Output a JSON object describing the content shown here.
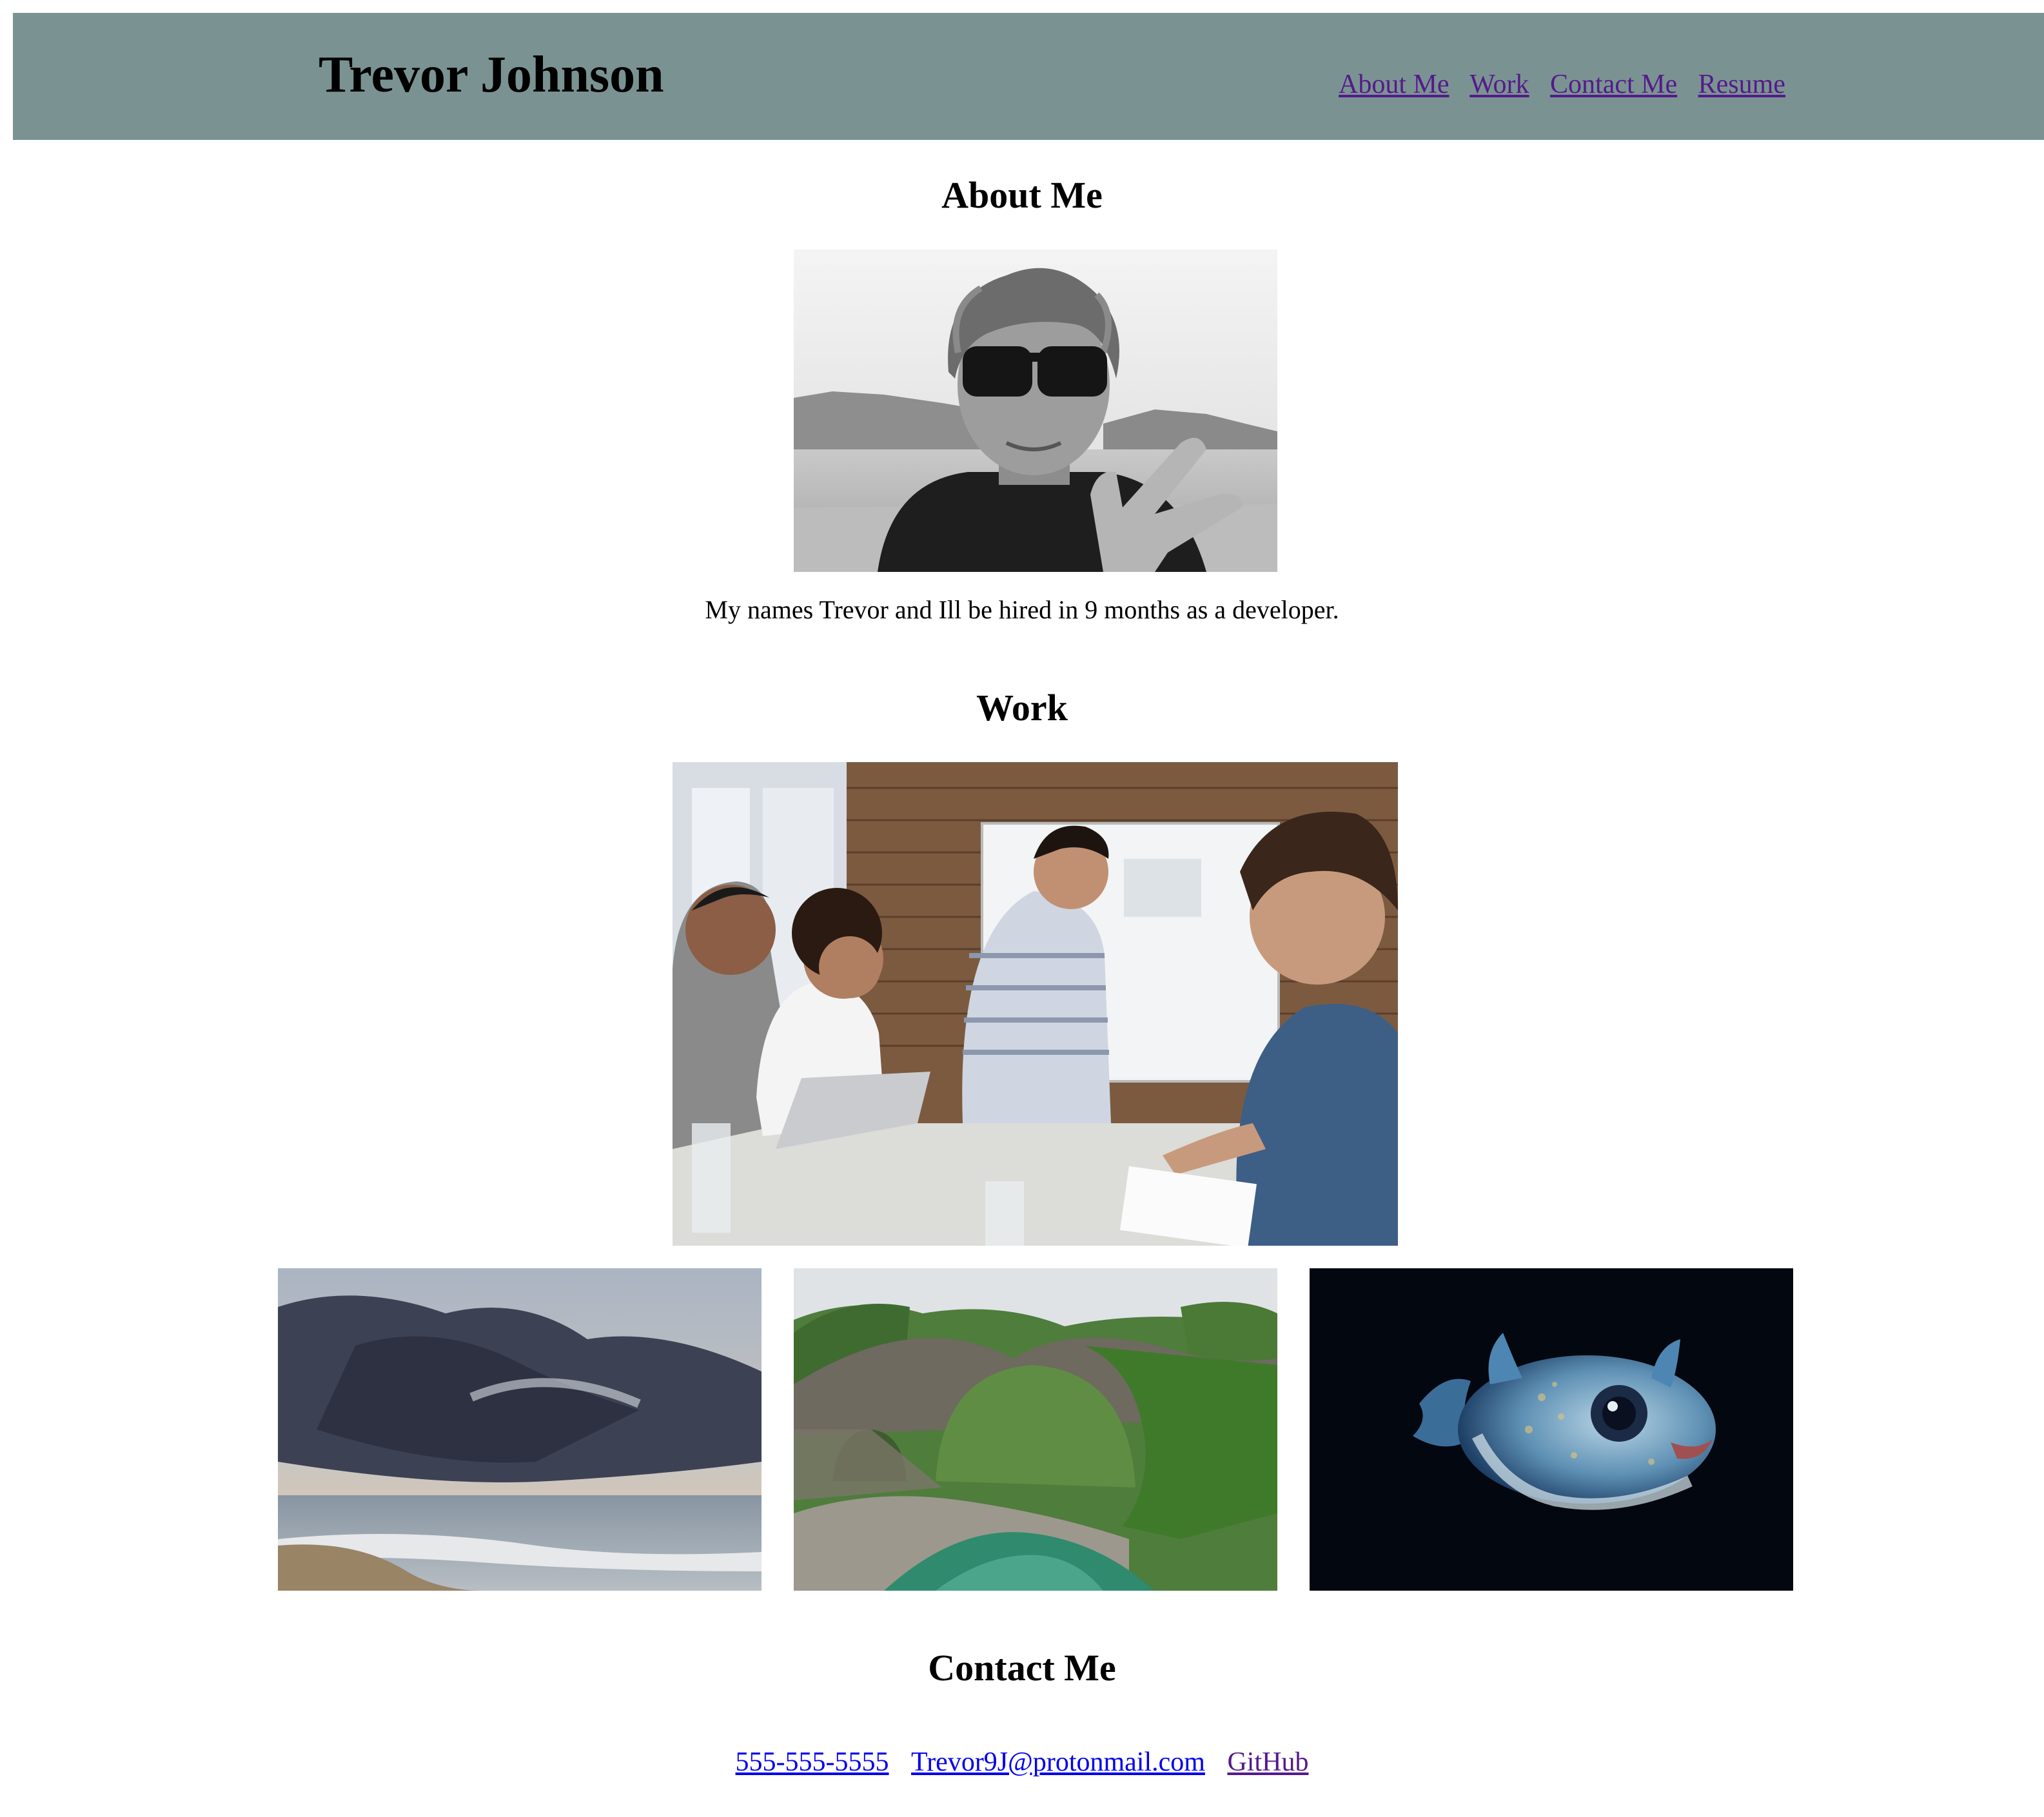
{
  "header": {
    "title": "Trevor Johnson",
    "nav": [
      "About Me",
      "Work",
      "Contact Me",
      "Resume"
    ]
  },
  "about": {
    "heading": "About Me",
    "text": "My names Trevor and Ill be hired in 9 months as a developer."
  },
  "work": {
    "heading": "Work"
  },
  "contact": {
    "heading": "Contact Me",
    "phone": "555-555-5555",
    "email": "Trevor9J@protonmail.com",
    "github": "GitHub"
  },
  "colors": {
    "header_bg": "#7a9392",
    "link_unvisited": "#0000ee",
    "link_visited": "#551a8b"
  }
}
